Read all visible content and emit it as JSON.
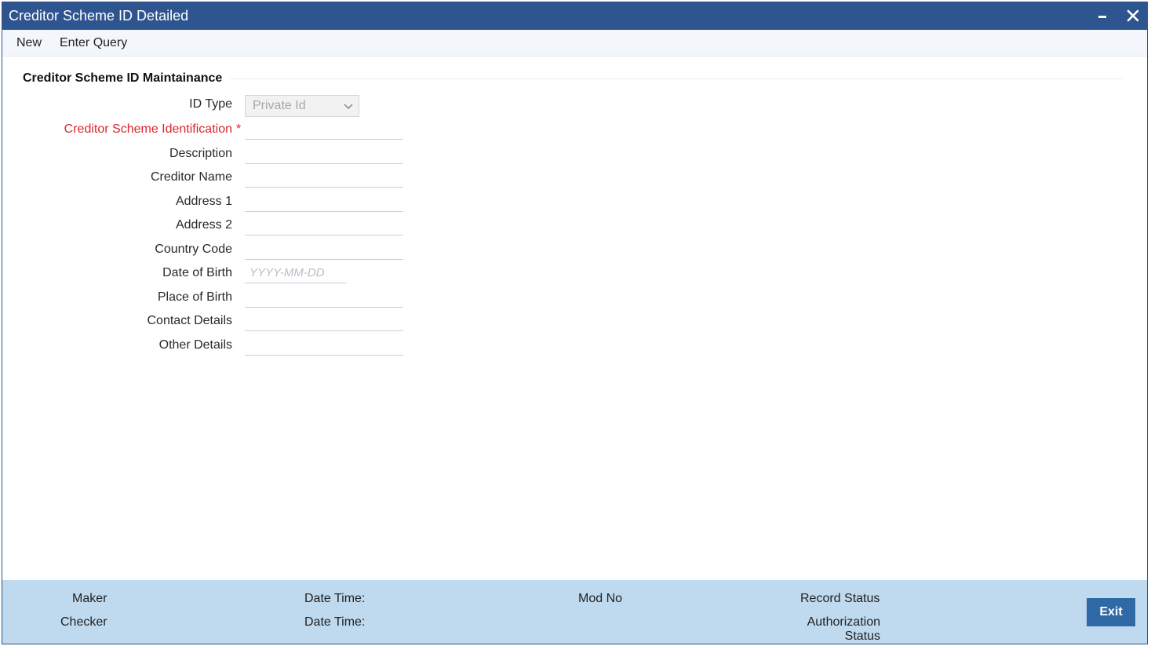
{
  "window": {
    "title": "Creditor Scheme ID Detailed",
    "minimize_icon": "minimize-icon",
    "close_icon": "close-icon"
  },
  "menu": {
    "new_label": "New",
    "enter_query_label": "Enter Query"
  },
  "section": {
    "title": "Creditor Scheme ID Maintainance"
  },
  "form": {
    "id_type": {
      "label": "ID Type",
      "value": "Private Id"
    },
    "creditor_scheme_identification": {
      "label": "Creditor Scheme Identification",
      "required_mark": "*",
      "value": ""
    },
    "description": {
      "label": "Description",
      "value": ""
    },
    "creditor_name": {
      "label": "Creditor Name",
      "value": ""
    },
    "address_1": {
      "label": "Address 1",
      "value": ""
    },
    "address_2": {
      "label": "Address 2",
      "value": ""
    },
    "country_code": {
      "label": "Country Code",
      "value": ""
    },
    "date_of_birth": {
      "label": "Date of Birth",
      "value": "",
      "placeholder": "YYYY-MM-DD"
    },
    "place_of_birth": {
      "label": "Place of Birth",
      "value": ""
    },
    "contact_details": {
      "label": "Contact Details",
      "value": ""
    },
    "other_details": {
      "label": "Other Details",
      "value": ""
    }
  },
  "footer": {
    "maker_label": "Maker",
    "checker_label": "Checker",
    "date_time_label_1": "Date Time:",
    "date_time_label_2": "Date Time:",
    "mod_no_label": "Mod No",
    "record_status_label": "Record Status",
    "authorization_status_line1": "Authorization",
    "authorization_status_line2": "Status",
    "exit_label": "Exit"
  },
  "colors": {
    "titlebar": "#2f5590",
    "required": "#d9272e",
    "footer": "#bfd9ee",
    "exit_button": "#2f6aa6"
  }
}
